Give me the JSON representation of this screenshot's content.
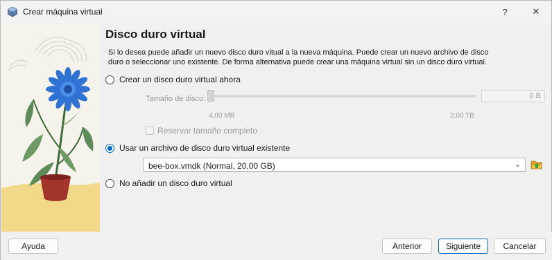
{
  "window": {
    "title": "Crear máquina virtual",
    "help_glyph": "?",
    "close_glyph": "✕"
  },
  "page": {
    "heading": "Disco duro virtual",
    "description": "Si lo desea puede añadir un nuevo disco duro vitual a la nueva máquina. Puede crear un nuevo archivo de disco duro o seleccionar uno existente. De forma alternativa puede crear una máquina virtual sin un disco duro virtual."
  },
  "options": {
    "create_new": {
      "label": "Crear un disco duro virtual ahora",
      "selected": false
    },
    "use_existing": {
      "label": "Usar un archivo de disco duro virtual existente",
      "selected": true
    },
    "no_disk": {
      "label": "No añadir un disco duro virtual",
      "selected": false
    }
  },
  "disk_size": {
    "label": "Tamaño de disco:",
    "value": "0 B",
    "min_label": "4,00 MB",
    "max_label": "2,00 TB",
    "slider_fraction": 0.0,
    "reserve_label": "Reservar tamaño completo",
    "reserve_checked": false
  },
  "existing_disk": {
    "selected": "bee-box.vmdk (Normal, 20,00 GB)",
    "folder_icon": "folder-open-icon"
  },
  "buttons": {
    "help": "Ayuda",
    "back": "Anterior",
    "next": "Siguiente",
    "cancel": "Cancelar"
  },
  "colors": {
    "accent": "#0067c0",
    "side_background": "#f6f3ec",
    "flower_blue": "#2f72d4",
    "pot": "#a3342b",
    "ground": "#f2d98a"
  }
}
